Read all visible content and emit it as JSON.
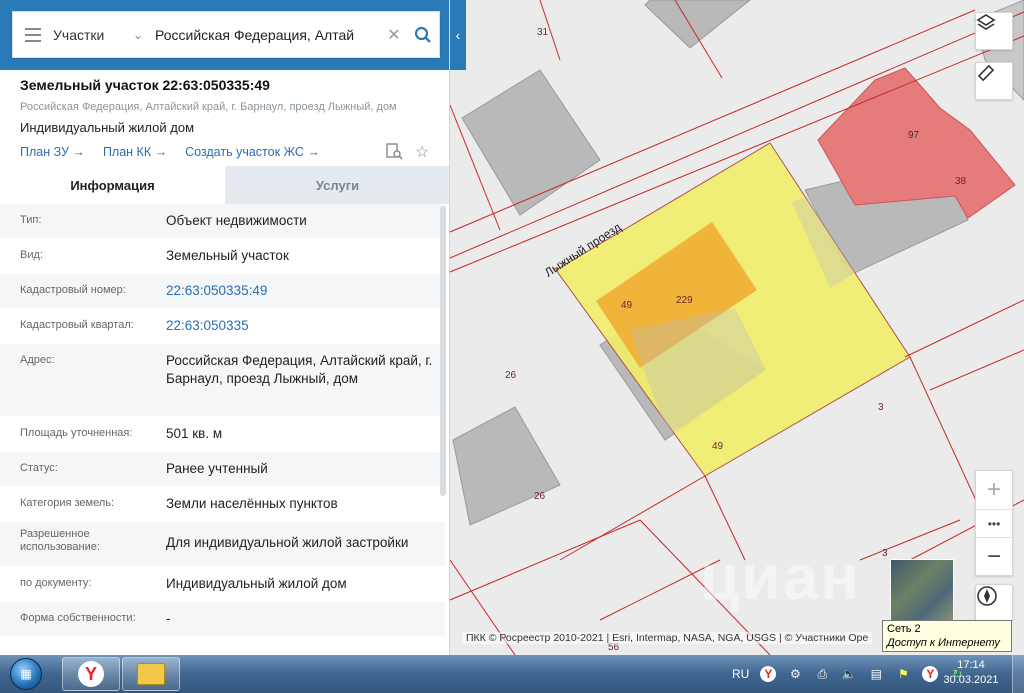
{
  "search": {
    "mode": "Участки",
    "value": "Российская Федерация, Алтай"
  },
  "object": {
    "title": "Земельный участок 22:63:050335:49",
    "address": "Российская Федерация, Алтайский край, г. Барнаул, проезд Лыжный, дом",
    "use": "Индивидуальный жилой дом"
  },
  "links": {
    "plan_zu": "План ЗУ →",
    "plan_kk": "План КК →",
    "create_zs": "Создать участок ЖС →"
  },
  "tabs": {
    "info": "Информация",
    "services": "Услуги"
  },
  "rows": [
    {
      "key": "Тип:",
      "value": "Объект недвижимости"
    },
    {
      "key": "Вид:",
      "value": "Земельный участок"
    },
    {
      "key": "Кадастровый номер:",
      "value": "22:63:050335:49"
    },
    {
      "key": "Кадастровый квартал:",
      "value": "22:63:050335"
    },
    {
      "key": "Адрес:",
      "value": "Российская Федерация, Алтайский край, г. Барнаул, проезд Лыжный, дом"
    },
    {
      "key": "Площадь уточненная:",
      "value": "501 кв. м"
    },
    {
      "key": "Статус:",
      "value": "Ранее учтенный"
    },
    {
      "key": "Категория земель:",
      "value": "Земли населённых пунктов"
    },
    {
      "key": "Разрешенное использование:",
      "value": "Для индивидуальной жилой застройки"
    },
    {
      "key": "по документу:",
      "value": "Индивидуальный жилой дом"
    },
    {
      "key": "Форма собственности:",
      "value": "-"
    }
  ],
  "map": {
    "street": "Лыжный проезд",
    "labels": {
      "l31": "31",
      "l97": "97",
      "l38": "38",
      "l49a": "49",
      "l229": "229",
      "l26a": "26",
      "l3a": "3",
      "l49b": "49",
      "l26b": "26",
      "l3b": "3",
      "l56": "56"
    },
    "attribution": "ПКК © Росреестр 2010-2021 | Esri, Intermap, NASA, NGA, USGS | © Участники Ope",
    "tooltip_line1": "Сеть  2",
    "tooltip_line2": "Доступ к Интернету",
    "zoom_in": "+",
    "zoom_more": "•••",
    "zoom_out": "−"
  },
  "taskbar": {
    "lang": "RU",
    "time": "17:14",
    "date": "30.03.2021"
  },
  "colors": {
    "accent": "#2a7ab8",
    "parcel": "#f2ee6a",
    "building_orange": "#f0b43a",
    "building_red": "#e57b7b"
  }
}
